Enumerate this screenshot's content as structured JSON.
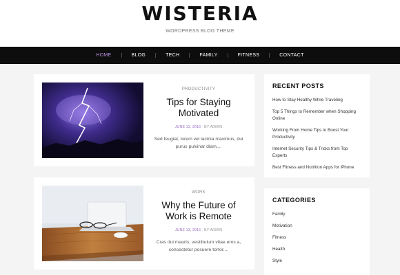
{
  "site": {
    "title": "WISTERIA",
    "tagline": "WORDPRESS BLOG THEME"
  },
  "nav": {
    "items": [
      "HOME",
      "BLOG",
      "TECH",
      "FAMILY",
      "FITNESS",
      "CONTACT"
    ],
    "active": "HOME"
  },
  "posts": [
    {
      "category": "PRODUCTIVITY",
      "title": "Tips for Staying Motivated",
      "date": "JUNE 13, 2016",
      "author": "BY ADMIN",
      "excerpt": "Sed feugiat, lorem vel lacinia maximus, dui purus pulvinar diam,...",
      "thumbnail": "purple lightning storm over mountains"
    },
    {
      "category": "WORK",
      "title": "Why the Future of Work is Remote",
      "date": "JUNE 13, 2016",
      "author": "BY ADMIN",
      "excerpt": "Cras dui mauris, vestibulum vitae eros a, consectetur posuere tortor....",
      "thumbnail": "laptop, glasses and mouse on wooden desk"
    }
  ],
  "recent_posts": {
    "title": "RECENT POSTS",
    "items": [
      "How to Stay Healthy While Traveling",
      "Top 5 Things to Remember when Shopping Online",
      "Working From Home Tips to Boost Your Productivity",
      "Internet Security Tips & Tricks from Top Experts",
      "Best Fitness and Nutrition Apps for iPhone"
    ]
  },
  "categories": {
    "title": "CATEGORIES",
    "items": [
      "Family",
      "Motivation",
      "Fitness",
      "Health",
      "Style"
    ]
  },
  "colors": {
    "accent": "#9b6fc2",
    "nav_background": "#0d0d0d",
    "page_background": "#f4f4f4"
  }
}
